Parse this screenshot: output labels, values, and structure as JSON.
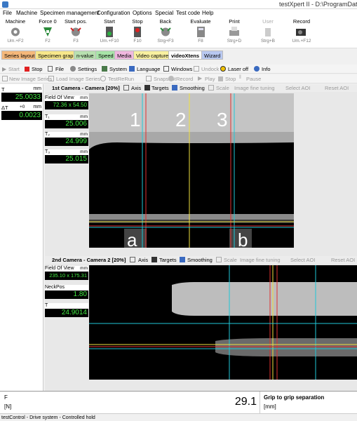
{
  "window": {
    "title": "testXpert II  -  D:\\ProgramData\\"
  },
  "menu": [
    "File",
    "Machine",
    "Specimen management",
    "Configuration",
    "Options",
    "Special",
    "Test code",
    "Help"
  ],
  "ribbon": {
    "machine": {
      "label": "Machine",
      "key": "Um.+F2"
    },
    "force0": {
      "label": "Force 0",
      "key": "F2"
    },
    "start_pos": {
      "label": "Start pos.",
      "key": "F3"
    },
    "start": {
      "label": "Start",
      "key": "Um.+F10"
    },
    "stop": {
      "label": "Stop",
      "key": "F10"
    },
    "back": {
      "label": "Back",
      "key": "Strg+F3"
    },
    "evaluate": {
      "label": "Evaluate",
      "key": "F8"
    },
    "print": {
      "label": "Print",
      "key": "Strg+D"
    },
    "user": {
      "label": "User",
      "key": "Strg+B"
    },
    "record": {
      "label": "Record",
      "key": "Um.+F12"
    }
  },
  "tabs": [
    "Series layout",
    "Specimen graph",
    "n-value",
    "Speed",
    "Media",
    "Video capture",
    "videoXtens",
    "Wizard"
  ],
  "toolbar1": {
    "start": "Start",
    "stop": "Stop",
    "file": "File",
    "settings": "Settings",
    "system": "System",
    "language": "Language",
    "windows": "Windows",
    "undock": "Undock",
    "laser": "Laser off",
    "info": "Info"
  },
  "toolbar2": {
    "new_series": "New Image Series",
    "load_series": "Load Image Series",
    "rerun": "TestReRun",
    "snapshot": "Snapshot",
    "record": "Record",
    "play": "Play",
    "stop": "Stop",
    "pause": "Pause"
  },
  "left": {
    "t": {
      "label": "T",
      "unit": "mm",
      "value": "25.0033"
    },
    "dt": {
      "label": "ΔT",
      "offset": "+0",
      "unit": "mm",
      "value": "0.0023"
    }
  },
  "cam1": {
    "title": "1st Camera - Camera [20%]",
    "axis": "Axis",
    "targets": "Targets",
    "smoothing": "Smoothing",
    "scale": "Scale",
    "fine": "Image fine tuning",
    "select_aoi": "Select AOI",
    "reset_aoi": "Reset AOI",
    "fov": {
      "label": "Field Of View",
      "unit": "mm",
      "value": "72.36 x 54.50"
    },
    "t1": {
      "label": "T₁",
      "unit": "mm",
      "value": "25.006"
    },
    "t2": {
      "label": "T₂",
      "unit": "mm",
      "value": "24.999"
    },
    "t3": {
      "label": "T₃",
      "unit": "mm",
      "value": "25.015"
    },
    "marks": [
      "1",
      "2",
      "3"
    ],
    "grips": [
      "a",
      "b"
    ]
  },
  "cam2": {
    "title": "2nd Camera - Camera 2 [20%]",
    "axis": "Axis",
    "targets": "Targets",
    "smoothing": "Smoothing",
    "scale": "Scale",
    "fine": "Image fine tuning",
    "select_aoi": "Select AOI",
    "reset_aoi": "Reset AOI",
    "fov": {
      "label": "Field Of View",
      "unit": "mm",
      "value": "235.10 x 175.31"
    },
    "neck": {
      "label": "NeckPos",
      "value": "1.80"
    },
    "t": {
      "label": "T",
      "value": "24.9014"
    }
  },
  "bottom": {
    "force_label": "F",
    "force_unit": "[N]",
    "value": "29.1",
    "name": "Grip to grip separation",
    "unit": "[mm]"
  },
  "status": "testControl - Drive system - Controlled hold",
  "colors": {
    "digit": "#42e842",
    "cyan_line": "#20c8d8",
    "yellow_line": "#f0e040",
    "red_line": "#e03030"
  }
}
